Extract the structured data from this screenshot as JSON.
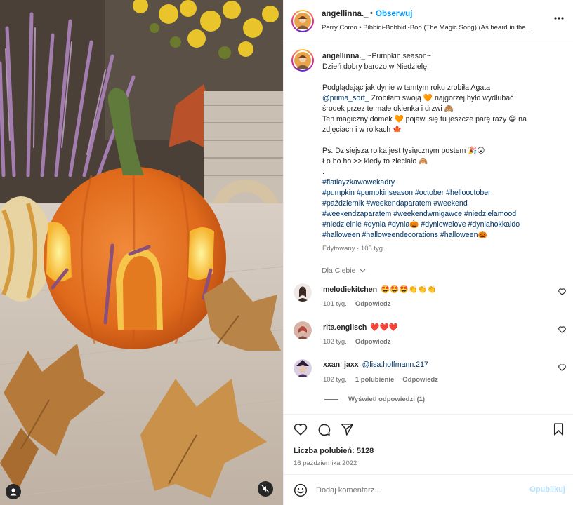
{
  "media": {
    "scene_description_icon": "pumpkin-house-photo",
    "user_tag_icon": "person-icon",
    "mute_icon": "speaker-muted-icon"
  },
  "header": {
    "username": "angellinna._",
    "separator": "•",
    "follow_label": "Obserwuj",
    "song": "Perry Como • Bibbidi-Bobbidi-Boo (The Magic Song) (As heard in the ..."
  },
  "caption": {
    "username": "angellinna._",
    "title": "~Pumpkin season~",
    "lines": [
      "Dzień dobry bardzo w Niedzielę!",
      "",
      "Podglądając jak dynie w tamtym roku zrobiła Agata",
      "@prima_sort_ Zrobiłam swoją 🧡 najgorzej było wydłubać",
      "środek przez te małe okienka i drzwi 🙈",
      "Ten magiczny domek 🧡 pojawi się tu jeszcze parę razy 😁 na",
      "zdjęciach i w rolkach 🍁",
      "",
      "Ps. Dzisiejsza rolka jest tysięcznym postem 🎉😮",
      "Ło ho ho >> kiedy to zleciało 🙈",
      "."
    ],
    "mention": "@prima_sort_",
    "hashtag_lines": [
      "#flatlayzkawowekadry",
      "#pumpkin #pumpkinseason #october #hellooctober",
      "#październik #weekendaparatem #weekend",
      "#weekendzaparatem #weekendwmigawce #niedzielamood",
      "#niedzielnie #dynia #dynia🎃 #dyniowelove #dyniahokkaido",
      "#halloween #halloweendecorations #halloween🎃"
    ],
    "meta": "Edytowany · 105 tyg."
  },
  "dla_ciebie": "Dla Ciebie",
  "comments": [
    {
      "username": "melodiekitchen",
      "text": "🤩🤩🤩👏👏👏",
      "time": "101 tyg.",
      "replies": "",
      "reply": "Odpowiedz",
      "avatar_color": "#6b4f45"
    },
    {
      "username": "rita.englisch",
      "text": "❤️❤️❤️",
      "time": "102 tyg.",
      "replies": "",
      "reply": "Odpowiedz",
      "avatar_color": "#b56a5e"
    },
    {
      "username": "xxan_jaxx",
      "text": "@lisa.hoffmann.217",
      "time": "102 tyg.",
      "replies": "1 polubienie",
      "reply": "Odpowiedz",
      "avatar_color": "#4a2f5c"
    }
  ],
  "view_replies": "Wyświetl odpowiedzi (1)",
  "actions": {
    "like_icon": "heart-icon",
    "comment_icon": "comment-icon",
    "share_icon": "send-icon",
    "save_icon": "bookmark-icon",
    "likes": "Liczba polubień: 5128",
    "date": "16 października 2022"
  },
  "comment_box": {
    "placeholder": "Dodaj komentarz...",
    "post_label": "Opublikuj"
  },
  "colors": {
    "accent": "#0095f6",
    "link": "#00376b",
    "muted": "#737373",
    "post_disabled": "#b2dffc"
  }
}
